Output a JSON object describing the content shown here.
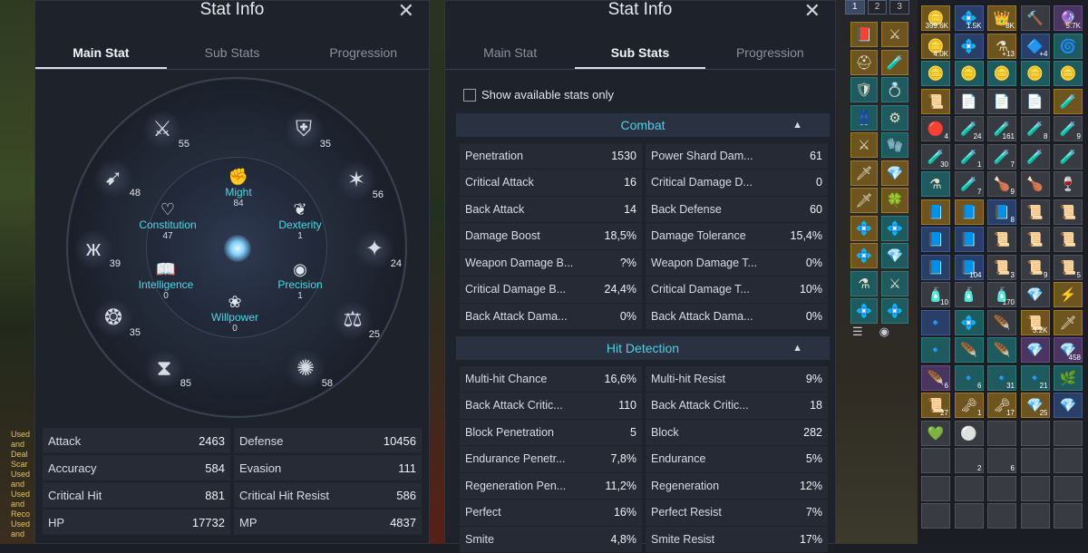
{
  "left_panel": {
    "title": "Stat Info",
    "tabs": [
      "Main Stat",
      "Sub Stats",
      "Progression"
    ],
    "active_tab": "Main Stat",
    "core_stats": [
      {
        "name": "Might",
        "value": "84",
        "icon": "fist-icon"
      },
      {
        "name": "Constitution",
        "value": "47",
        "icon": "heart-icon"
      },
      {
        "name": "Dexterity",
        "value": "1",
        "icon": "feather-icon"
      },
      {
        "name": "Intelligence",
        "value": "0",
        "icon": "book-icon"
      },
      {
        "name": "Precision",
        "value": "1",
        "icon": "eye-icon"
      },
      {
        "name": "Willpower",
        "value": "0",
        "icon": "lotus-icon"
      }
    ],
    "ring_nodes": [
      {
        "value": "55",
        "icon": "sword-emblem-icon"
      },
      {
        "value": "35",
        "icon": "shield-emblem-icon"
      },
      {
        "value": "56",
        "icon": "star-emblem-icon"
      },
      {
        "value": "24",
        "icon": "compass-emblem-icon"
      },
      {
        "value": "25",
        "icon": "scales-emblem-icon"
      },
      {
        "value": "58",
        "icon": "wing-emblem-icon"
      },
      {
        "value": "85",
        "icon": "hourglass-emblem-icon"
      },
      {
        "value": "35",
        "icon": "tree-emblem-icon"
      },
      {
        "value": "39",
        "icon": "butterfly-emblem-icon"
      },
      {
        "value": "48",
        "icon": "bow-emblem-icon"
      }
    ],
    "stats": [
      [
        {
          "label": "Attack",
          "value": "2463"
        },
        {
          "label": "Defense",
          "value": "10456"
        }
      ],
      [
        {
          "label": "Accuracy",
          "value": "584"
        },
        {
          "label": "Evasion",
          "value": "111"
        }
      ],
      [
        {
          "label": "Critical Hit",
          "value": "881"
        },
        {
          "label": "Critical Hit Resist",
          "value": "586"
        }
      ],
      [
        {
          "label": "HP",
          "value": "17732"
        },
        {
          "label": "MP",
          "value": "4837"
        }
      ]
    ]
  },
  "right_panel": {
    "title": "Stat Info",
    "tabs": [
      "Main Stat",
      "Sub Stats",
      "Progression"
    ],
    "active_tab": "Sub Stats",
    "checkbox_label": "Show available stats only",
    "sections": [
      {
        "title": "Combat",
        "rows": [
          [
            {
              "label": "Penetration",
              "value": "1530"
            },
            {
              "label": "Power Shard Dam...",
              "value": "61"
            }
          ],
          [
            {
              "label": "Critical Attack",
              "value": "16"
            },
            {
              "label": "Critical Damage D...",
              "value": "0"
            }
          ],
          [
            {
              "label": "Back Attack",
              "value": "14"
            },
            {
              "label": "Back Defense",
              "value": "60"
            }
          ],
          [
            {
              "label": "Damage Boost",
              "value": "18,5%"
            },
            {
              "label": "Damage Tolerance",
              "value": "15,4%"
            }
          ],
          [
            {
              "label": "Weapon Damage B...",
              "value": "?%"
            },
            {
              "label": "Weapon Damage T...",
              "value": "0%"
            }
          ],
          [
            {
              "label": "Critical Damage B...",
              "value": "24,4%"
            },
            {
              "label": "Critical Damage T...",
              "value": "10%"
            }
          ],
          [
            {
              "label": "Back Attack Dama...",
              "value": "0%"
            },
            {
              "label": "Back Attack Dama...",
              "value": "0%"
            }
          ]
        ]
      },
      {
        "title": "Hit Detection",
        "rows": [
          [
            {
              "label": "Multi-hit Chance",
              "value": "16,6%"
            },
            {
              "label": "Multi-hit Resist",
              "value": "9%"
            }
          ],
          [
            {
              "label": "Back Attack Critic...",
              "value": "110"
            },
            {
              "label": "Back Attack Critic...",
              "value": "18"
            }
          ],
          [
            {
              "label": "Block Penetration",
              "value": "5"
            },
            {
              "label": "Block",
              "value": "282"
            }
          ],
          [
            {
              "label": "Endurance Penetr...",
              "value": "7,8%"
            },
            {
              "label": "Endurance",
              "value": "5%"
            }
          ],
          [
            {
              "label": "Regeneration Pen...",
              "value": "11,2%"
            },
            {
              "label": "Regeneration",
              "value": "12%"
            }
          ],
          [
            {
              "label": "Perfect",
              "value": "16%"
            },
            {
              "label": "Perfect Resist",
              "value": "7%"
            }
          ],
          [
            {
              "label": "Smite",
              "value": "4,8%"
            },
            {
              "label": "Smite Resist",
              "value": "17%"
            }
          ]
        ]
      }
    ]
  },
  "inventory": {
    "page_tabs": [
      "1",
      "2",
      "3"
    ],
    "active_page": "1",
    "main_counts": [
      "399.6K",
      "1.5K",
      "8K",
      "",
      "5.7K",
      "4.0K",
      "",
      "+13",
      "+4",
      "",
      "",
      "",
      "",
      "",
      "",
      "",
      "",
      "",
      "",
      "",
      "4",
      "24",
      "161",
      "8",
      "9",
      "30",
      "1",
      "7",
      "",
      "",
      "",
      "7",
      "9",
      "",
      "",
      "",
      "",
      "8",
      "",
      "",
      "",
      "",
      "",
      "",
      "",
      "",
      "104",
      "3",
      "9",
      "5",
      "10",
      "",
      "170",
      "",
      "",
      "",
      "",
      "",
      "3.2K",
      "",
      "",
      "",
      "",
      "",
      "458",
      "6",
      "6",
      "31",
      "21",
      "",
      "27",
      "1",
      "17",
      "25",
      "",
      "",
      "",
      "",
      "",
      "",
      "",
      "2",
      "6"
    ],
    "colors": {
      "teal": "#1f5a5e",
      "gold": "#6e5520",
      "purple": "#4a3560",
      "blue": "#2a3f68"
    }
  },
  "side_text": [
    "Used",
    "and",
    "Deal",
    "Scar",
    "Used",
    "and",
    "Used",
    "and",
    "Reco",
    "Used",
    "and"
  ]
}
